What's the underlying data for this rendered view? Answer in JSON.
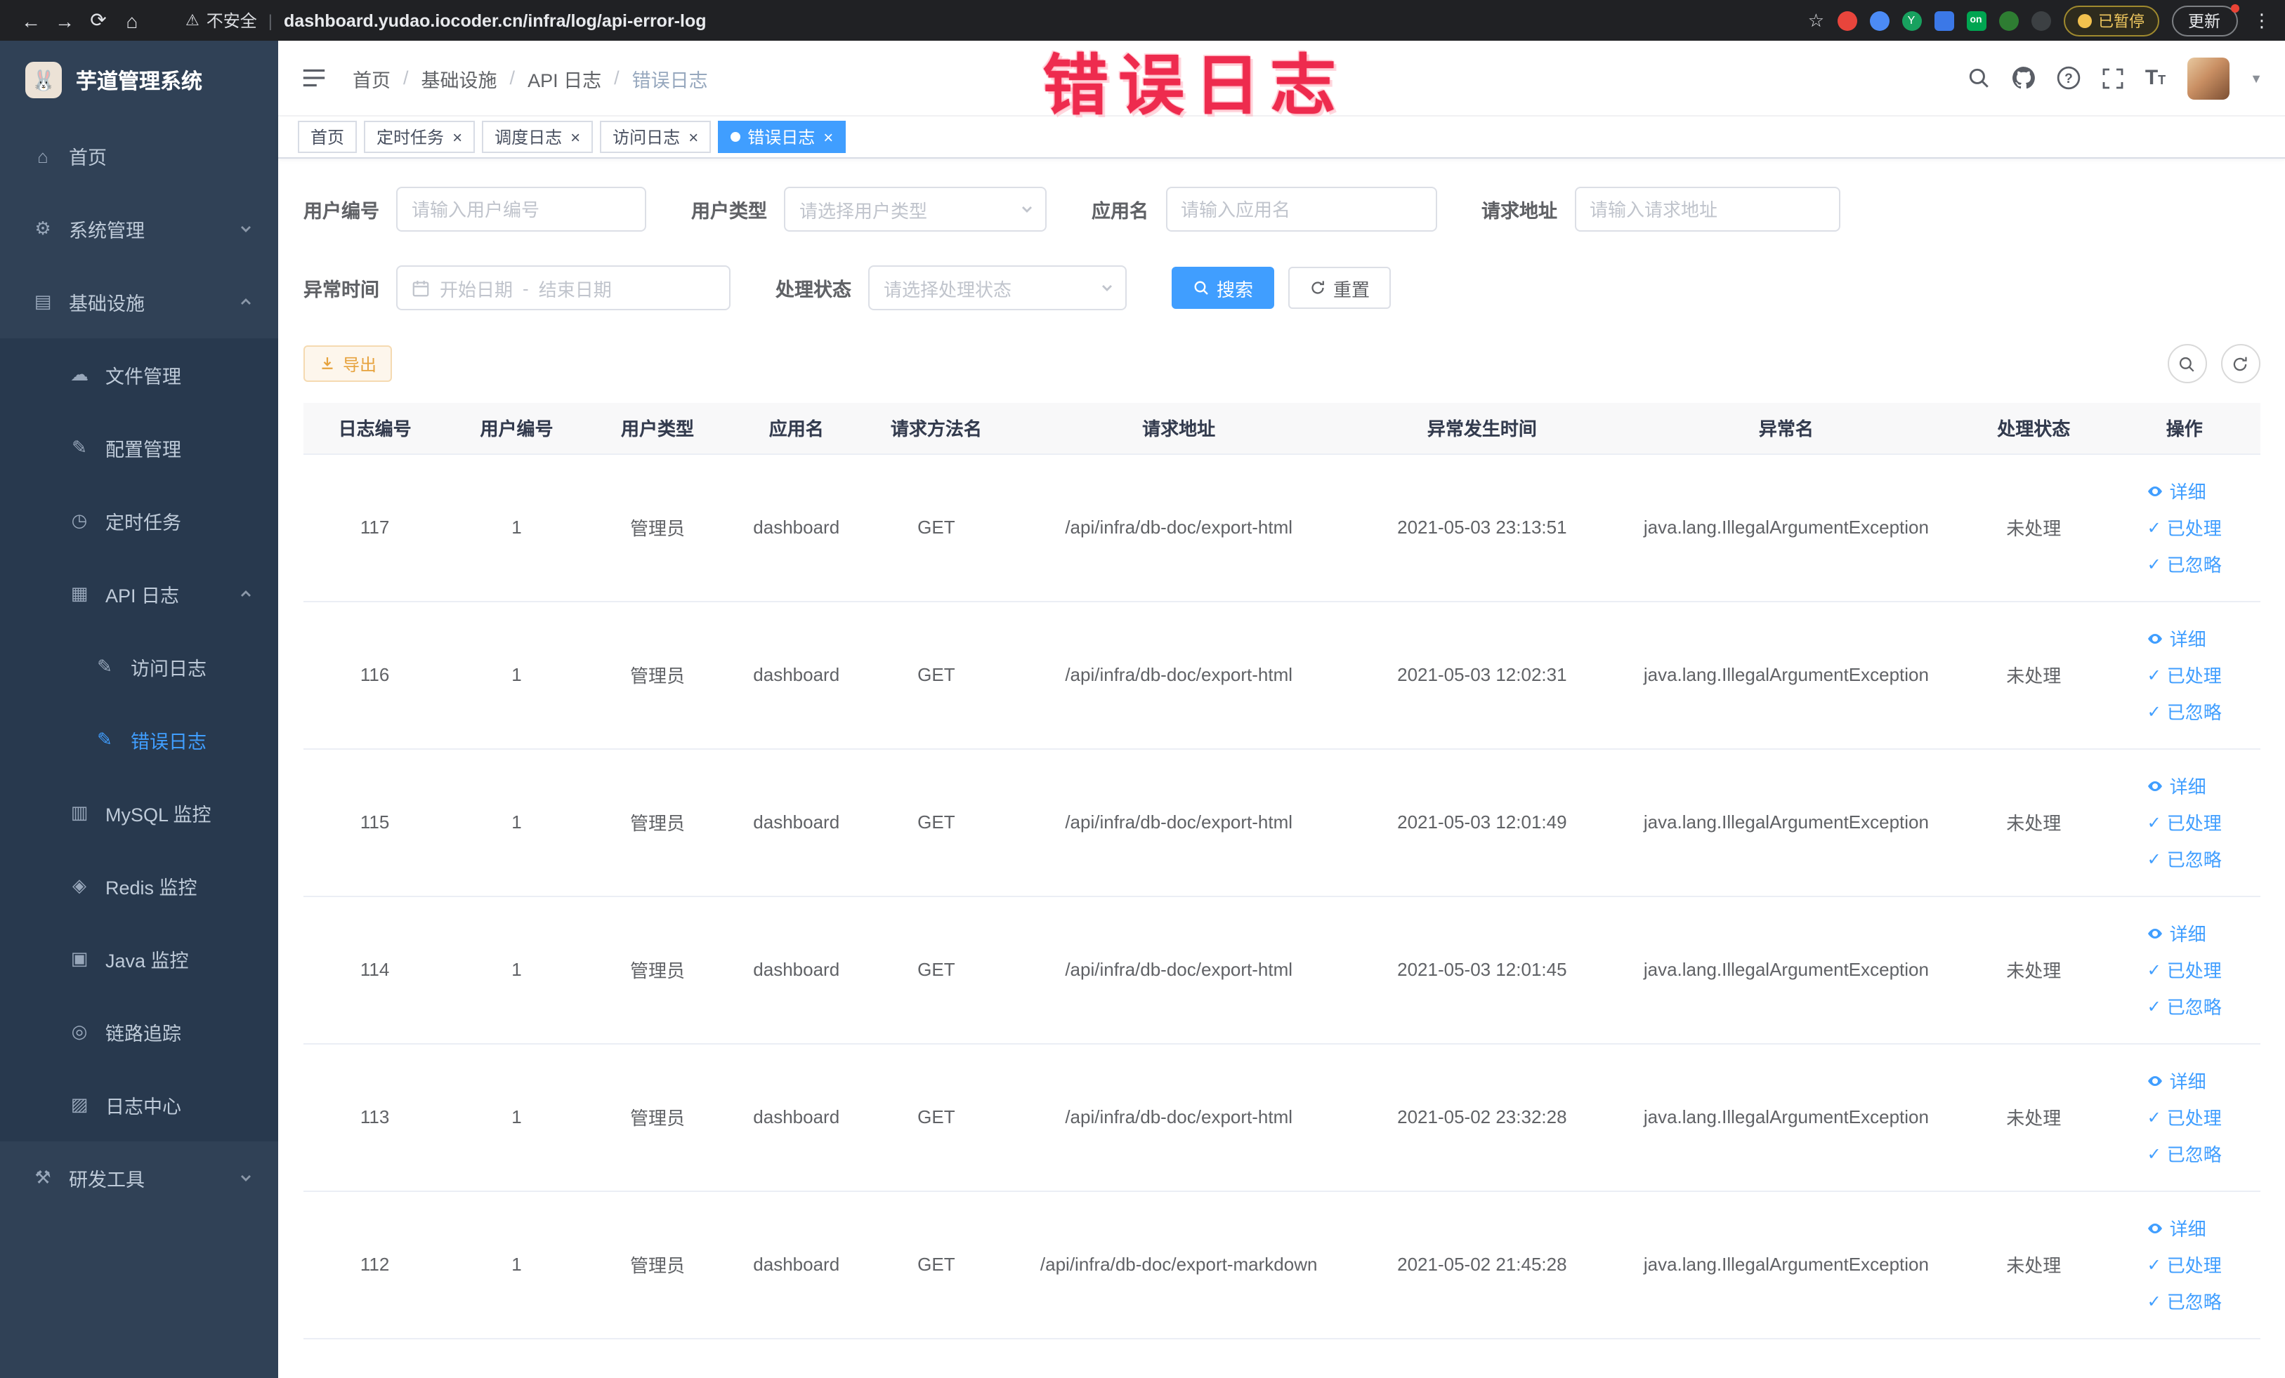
{
  "browser": {
    "security_label": "不安全",
    "url": "dashboard.yudao.iocoder.cn/infra/log/api-error-log",
    "paused_badge": "已暂停",
    "update_button": "更新"
  },
  "annotation": {
    "text": "错误日志"
  },
  "sidebar": {
    "logo_title": "芋道管理系统",
    "items": [
      {
        "key": "home",
        "label": "首页",
        "icon": "home",
        "level": 1
      },
      {
        "key": "system",
        "label": "系统管理",
        "icon": "gear",
        "level": 1,
        "chevron": "down"
      },
      {
        "key": "infra",
        "label": "基础设施",
        "icon": "infra",
        "level": 1,
        "chevron": "up"
      },
      {
        "key": "file",
        "label": "文件管理",
        "icon": "file",
        "level": 2
      },
      {
        "key": "config",
        "label": "配置管理",
        "icon": "config",
        "level": 2
      },
      {
        "key": "job",
        "label": "定时任务",
        "icon": "timer",
        "level": 2
      },
      {
        "key": "api-log",
        "label": "API 日志",
        "icon": "apilog",
        "level": 2,
        "chevron": "up"
      },
      {
        "key": "access-log",
        "label": "访问日志",
        "icon": "doc",
        "level": 3
      },
      {
        "key": "error-log",
        "label": "错误日志",
        "icon": "doc",
        "level": 3,
        "active": true
      },
      {
        "key": "mysql",
        "label": "MySQL 监控",
        "icon": "mysql",
        "level": 2
      },
      {
        "key": "redis",
        "label": "Redis 监控",
        "icon": "redis",
        "level": 2
      },
      {
        "key": "java",
        "label": "Java 监控",
        "icon": "java",
        "level": 2
      },
      {
        "key": "trace",
        "label": "链路追踪",
        "icon": "trace",
        "level": 2
      },
      {
        "key": "log-center",
        "label": "日志中心",
        "icon": "logcenter",
        "level": 2
      },
      {
        "key": "dev-tools",
        "label": "研发工具",
        "icon": "tools",
        "level": 1,
        "chevron": "down"
      }
    ]
  },
  "breadcrumb": {
    "separator": "/",
    "items": [
      "首页",
      "基础设施",
      "API 日志",
      "错误日志"
    ]
  },
  "tabs": [
    {
      "key": "home",
      "label": "首页",
      "closable": false,
      "active": false
    },
    {
      "key": "job",
      "label": "定时任务",
      "closable": true,
      "active": false
    },
    {
      "key": "job-log",
      "label": "调度日志",
      "closable": true,
      "active": false
    },
    {
      "key": "access-log",
      "label": "访问日志",
      "closable": true,
      "active": false
    },
    {
      "key": "error-log",
      "label": "错误日志",
      "closable": true,
      "active": true
    }
  ],
  "filters": {
    "user_id_label": "用户编号",
    "user_id_placeholder": "请输入用户编号",
    "user_type_label": "用户类型",
    "user_type_placeholder": "请选择用户类型",
    "app_name_label": "应用名",
    "app_name_placeholder": "请输入应用名",
    "request_url_label": "请求地址",
    "request_url_placeholder": "请输入请求地址",
    "exception_time_label": "异常时间",
    "start_date_placeholder": "开始日期",
    "end_date_placeholder": "结束日期",
    "range_separator": "-",
    "process_status_label": "处理状态",
    "process_status_placeholder": "请选择处理状态",
    "search_button": "搜索",
    "reset_button": "重置"
  },
  "toolbar": {
    "export_button": "导出"
  },
  "table": {
    "columns": [
      "日志编号",
      "用户编号",
      "用户类型",
      "应用名",
      "请求方法名",
      "请求地址",
      "异常发生时间",
      "异常名",
      "处理状态",
      "操作"
    ],
    "actions": [
      "详细",
      "已处理",
      "已忽略"
    ],
    "rows": [
      {
        "id": "117",
        "user_id": "1",
        "user_type": "管理员",
        "app": "dashboard",
        "method": "GET",
        "url": "/api/infra/db-doc/export-html",
        "time": "2021-05-03 23:13:51",
        "exception": "java.lang.IllegalArgumentException",
        "status": "未处理"
      },
      {
        "id": "116",
        "user_id": "1",
        "user_type": "管理员",
        "app": "dashboard",
        "method": "GET",
        "url": "/api/infra/db-doc/export-html",
        "time": "2021-05-03 12:02:31",
        "exception": "java.lang.IllegalArgumentException",
        "status": "未处理"
      },
      {
        "id": "115",
        "user_id": "1",
        "user_type": "管理员",
        "app": "dashboard",
        "method": "GET",
        "url": "/api/infra/db-doc/export-html",
        "time": "2021-05-03 12:01:49",
        "exception": "java.lang.IllegalArgumentException",
        "status": "未处理"
      },
      {
        "id": "114",
        "user_id": "1",
        "user_type": "管理员",
        "app": "dashboard",
        "method": "GET",
        "url": "/api/infra/db-doc/export-html",
        "time": "2021-05-03 12:01:45",
        "exception": "java.lang.IllegalArgumentException",
        "status": "未处理"
      },
      {
        "id": "113",
        "user_id": "1",
        "user_type": "管理员",
        "app": "dashboard",
        "method": "GET",
        "url": "/api/infra/db-doc/export-html",
        "time": "2021-05-02 23:32:28",
        "exception": "java.lang.IllegalArgumentException",
        "status": "未处理"
      },
      {
        "id": "112",
        "user_id": "1",
        "user_type": "管理员",
        "app": "dashboard",
        "method": "GET",
        "url": "/api/infra/db-doc/export-markdown",
        "time": "2021-05-02 21:45:28",
        "exception": "java.lang.IllegalArgumentException",
        "status": "未处理"
      }
    ]
  }
}
